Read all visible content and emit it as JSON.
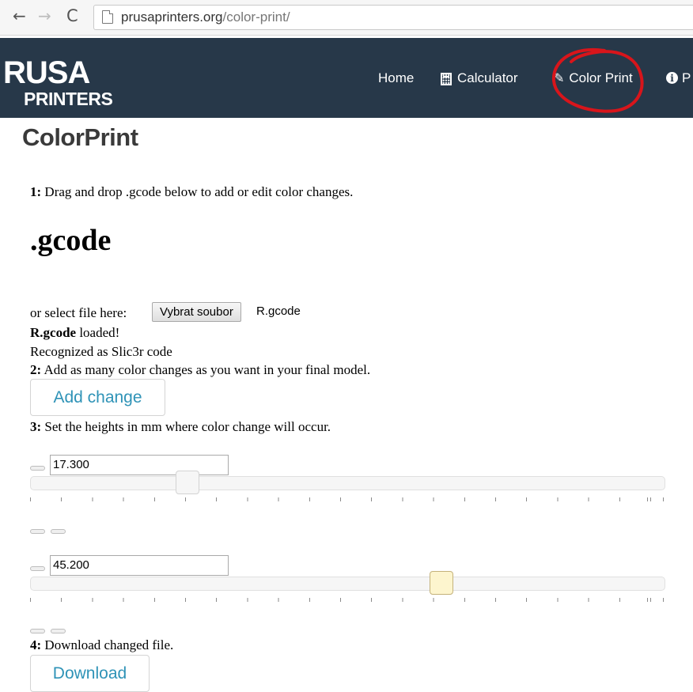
{
  "browser": {
    "url_host": "prusaprinters.org",
    "url_path": "/color-print/",
    "back_icon": "←",
    "forward_icon": "→",
    "reload_icon": "C"
  },
  "site": {
    "logo_line1": "RUSA",
    "logo_line2": "PRINTERS",
    "nav": {
      "home": "Home",
      "calculator": "Calculator",
      "color_print": "Color Print",
      "info_partial": "P"
    },
    "colors": {
      "header_bg": "#273849",
      "link_blue": "#2f93b7",
      "annotation_red": "#d8151b"
    }
  },
  "page": {
    "title": "ColorPrint",
    "step1_num": "1:",
    "step1_text": " Drag and drop .gcode below to add or edit color changes.",
    "drop_heading": ".gcode",
    "select_label": "or select file here:",
    "file_button": "Vybrat soubor",
    "file_name": "R.gcode",
    "loaded_name": "R.gcode",
    "loaded_text": " loaded!",
    "recognized_text": "Recognized as Slic3r code",
    "step2_num": "2:",
    "step2_text": " Add as many color changes as you want in your final model.",
    "add_button": "Add change",
    "step3_num": "3:",
    "step3_text": " Set the heights in mm where color change will occur.",
    "changes": [
      {
        "height": "17.300",
        "slider_fraction": 0.25
      },
      {
        "height": "45.200",
        "slider_fraction": 0.65
      }
    ],
    "step4_num": "4:",
    "step4_text": " Download changed file.",
    "download_button": "Download"
  }
}
